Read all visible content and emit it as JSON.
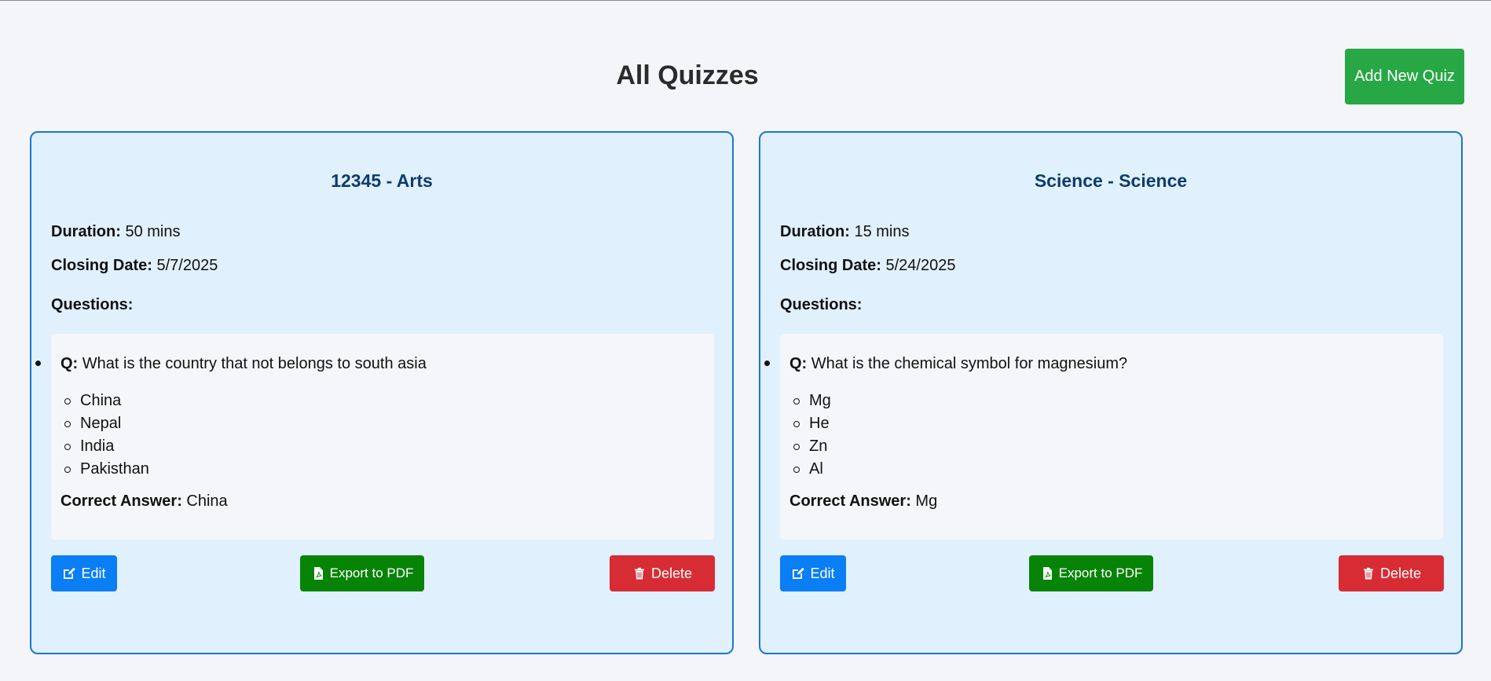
{
  "header": {
    "title": "All Quizzes",
    "add_button_label": "Add New Quiz"
  },
  "quizzes": [
    {
      "title": "12345 - Arts",
      "duration_label": "Duration:",
      "duration": "50 mins",
      "closing_label": "Closing Date:",
      "closing_date": "5/7/2025",
      "questions_label": "Questions:",
      "question_prefix": "Q:",
      "question": "What is the country that not belongs to south asia",
      "options": [
        "China",
        "Nepal",
        "India",
        "Pakisthan"
      ],
      "answer_label": "Correct Answer:",
      "answer": "China",
      "edit_label": "Edit",
      "export_label": "Export to PDF",
      "delete_label": "Delete"
    },
    {
      "title": "Science - Science",
      "duration_label": "Duration:",
      "duration": "15 mins",
      "closing_label": "Closing Date:",
      "closing_date": "5/24/2025",
      "questions_label": "Questions:",
      "question_prefix": "Q:",
      "question": "What is the chemical symbol for magnesium?",
      "options": [
        "Mg",
        "He",
        "Zn",
        "Al"
      ],
      "answer_label": "Correct Answer:",
      "answer": "Mg",
      "edit_label": "Edit",
      "export_label": "Export to PDF",
      "delete_label": "Delete"
    }
  ],
  "icons": {
    "edit": "edit-icon",
    "export": "pdf-file-icon",
    "delete": "trash-icon"
  },
  "colors": {
    "add": "#28a745",
    "edit": "#0a7ef5",
    "export": "#078307",
    "delete": "#d72c33",
    "card_border": "#1976d2"
  }
}
